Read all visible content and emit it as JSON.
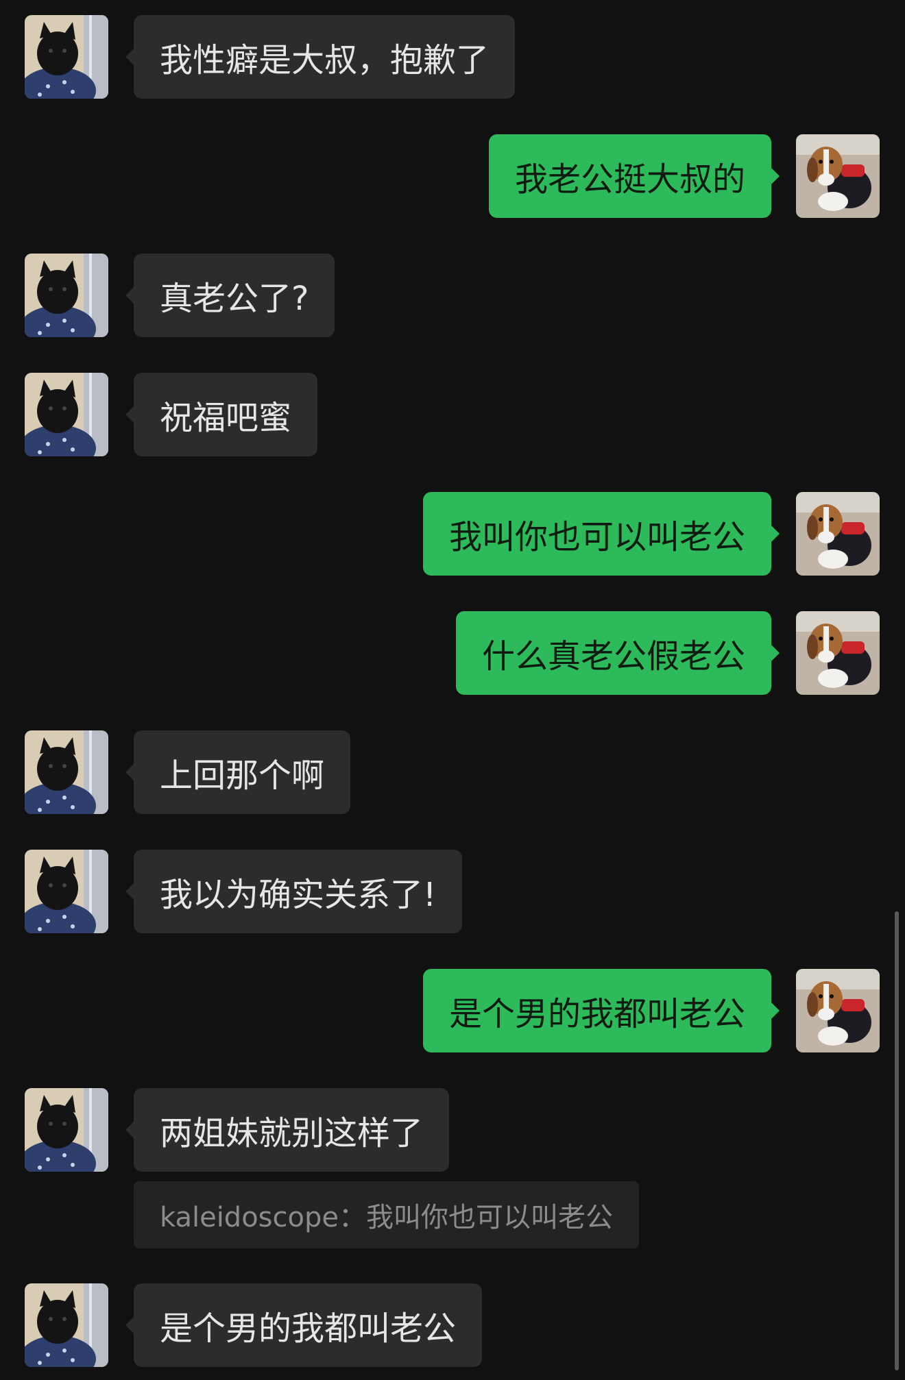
{
  "messages": [
    {
      "side": "in",
      "text": "我性癖是大叔，抱歉了"
    },
    {
      "side": "out",
      "text": "我老公挺大叔的"
    },
    {
      "side": "in",
      "text": "真老公了?"
    },
    {
      "side": "in",
      "text": "祝福吧蜜"
    },
    {
      "side": "out",
      "text": "我叫你也可以叫老公"
    },
    {
      "side": "out",
      "text": "什么真老公假老公"
    },
    {
      "side": "in",
      "text": "上回那个啊"
    },
    {
      "side": "in",
      "text": "我以为确实关系了!"
    },
    {
      "side": "out",
      "text": "是个男的我都叫老公"
    },
    {
      "side": "in",
      "text": "两姐妹就别这样了"
    },
    {
      "quote": "kaleidoscope：我叫你也可以叫老公"
    },
    {
      "side": "in",
      "text": "是个男的我都叫老公"
    }
  ],
  "avatars": {
    "contact": "black-puppy-avatar",
    "self": "beagle-puppy-avatar"
  },
  "colors": {
    "background": "#111111",
    "incoming_bubble": "#2c2c2c",
    "outgoing_bubble": "#2dba5b"
  }
}
